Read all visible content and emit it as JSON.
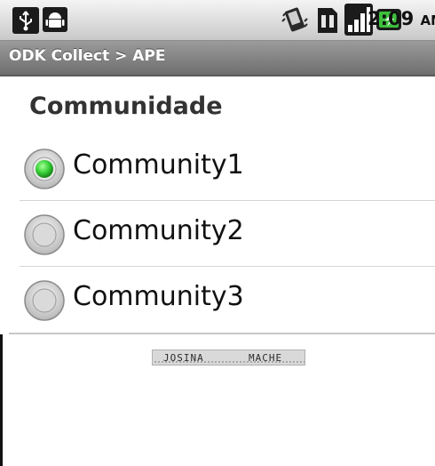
{
  "status_bar": {
    "time": "2:09",
    "ampm": "AM",
    "icons": [
      "usb-icon",
      "android-icon",
      "vibrate-icon",
      "sim-card-icon",
      "signal-icon",
      "battery-charging-icon"
    ]
  },
  "title_bar": {
    "title": "ODK Collect > APE"
  },
  "question": {
    "label": "Communidade",
    "options": [
      {
        "label": "Community1",
        "selected": true
      },
      {
        "label": "Community2",
        "selected": false
      },
      {
        "label": "Community3",
        "selected": false
      }
    ]
  },
  "signature": {
    "text": "JOSINA MACHE"
  },
  "colors": {
    "selected_radio": "#39d239",
    "title_bar": "#808080",
    "status_bar": "#e0e0e0"
  }
}
